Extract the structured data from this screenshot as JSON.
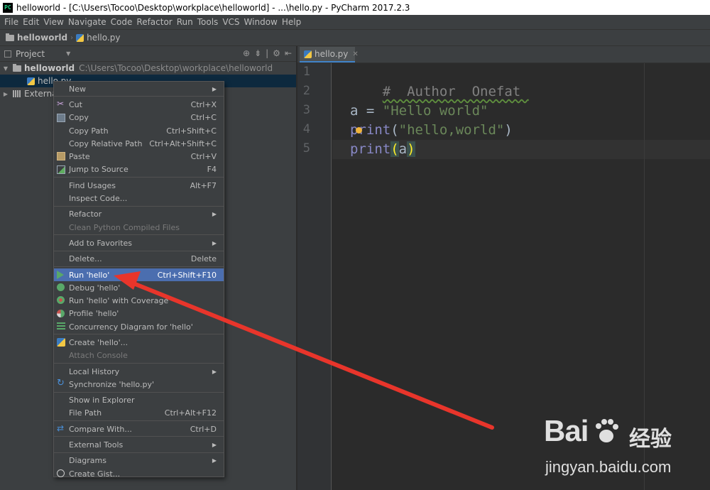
{
  "window": {
    "title": "helloworld - [C:\\Users\\Tocoo\\Desktop\\workplace\\helloworld] - ...\\hello.py - PyCharm 2017.2.3",
    "app_icon_text": "PC"
  },
  "menubar": [
    "File",
    "Edit",
    "View",
    "Navigate",
    "Code",
    "Refactor",
    "Run",
    "Tools",
    "VCS",
    "Window",
    "Help"
  ],
  "breadcrumb": {
    "project": "helloworld",
    "file": "hello.py"
  },
  "project_panel": {
    "title": "Project",
    "tree": {
      "root_name": "helloworld",
      "root_path": "C:\\Users\\Tocoo\\Desktop\\workplace\\helloworld",
      "file_name": "hello.py",
      "external": "External Libraries"
    }
  },
  "editor": {
    "tab_label": "hello.py",
    "line_numbers": [
      "1",
      "2",
      "3",
      "4",
      "5"
    ],
    "comment": "#  Author  Onefat ",
    "line3": {
      "ident": "a = ",
      "string": "\"Hello world\""
    },
    "line4": {
      "builtin": "print",
      "open": "(",
      "string": "\"hello,world\"",
      "close": ")"
    },
    "line5": {
      "builtin": "print",
      "open": "(",
      "arg": "a",
      "close": ")"
    }
  },
  "context_menu": {
    "new": "New",
    "cut": "Cut",
    "cut_sc": "Ctrl+X",
    "copy": "Copy",
    "copy_sc": "Ctrl+C",
    "copy_path": "Copy Path",
    "copy_path_sc": "Ctrl+Shift+C",
    "copy_rel": "Copy Relative Path",
    "copy_rel_sc": "Ctrl+Alt+Shift+C",
    "paste": "Paste",
    "paste_sc": "Ctrl+V",
    "jump": "Jump to Source",
    "jump_sc": "F4",
    "find_usages": "Find Usages",
    "find_usages_sc": "Alt+F7",
    "inspect": "Inspect Code...",
    "refactor": "Refactor",
    "clean": "Clean Python Compiled Files",
    "favorites": "Add to Favorites",
    "delete": "Delete...",
    "delete_sc": "Delete",
    "run": "Run 'hello'",
    "run_sc": "Ctrl+Shift+F10",
    "debug": "Debug 'hello'",
    "coverage": "Run 'hello' with Coverage",
    "profile": "Profile 'hello'",
    "concurrency": "Concurrency Diagram for  'hello'",
    "create": "Create 'hello'...",
    "attach": "Attach Console",
    "local_history": "Local History",
    "synchronize": "Synchronize 'hello.py'",
    "explorer": "Show in Explorer",
    "file_path": "File Path",
    "file_path_sc": "Ctrl+Alt+F12",
    "compare": "Compare With...",
    "compare_sc": "Ctrl+D",
    "external_tools": "External Tools",
    "diagrams": "Diagrams",
    "gist": "Create Gist..."
  },
  "watermark": {
    "logo": "Bai",
    "cn": "经验",
    "url": "jingyan.baidu.com"
  },
  "colors": {
    "accent": "#4b6eaf",
    "arrow": "#e8352b",
    "background": "#2b2b2b",
    "panel": "#3c3f41"
  }
}
